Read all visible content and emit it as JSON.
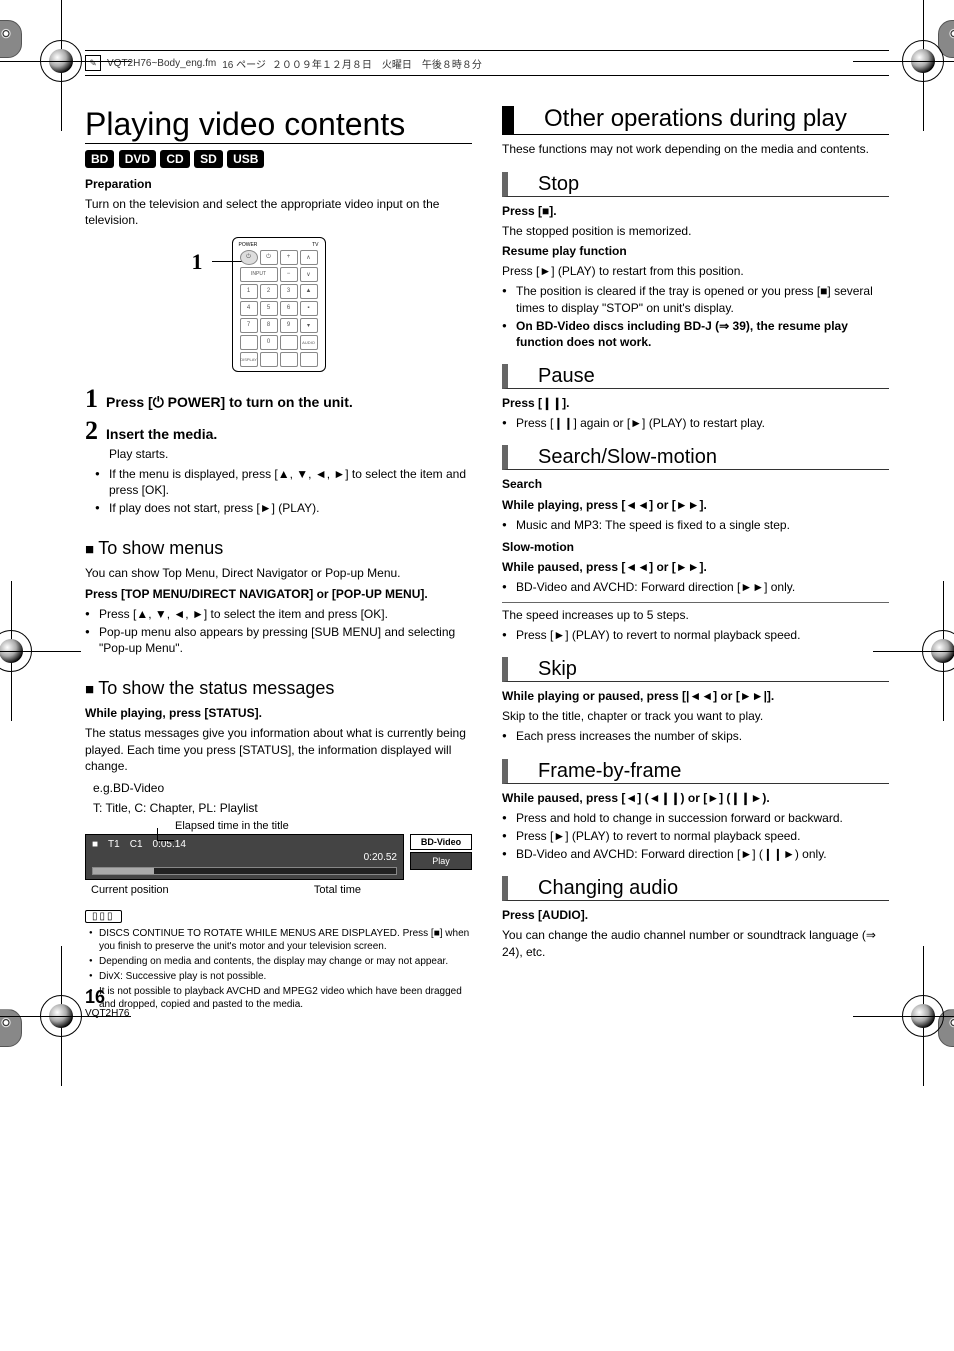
{
  "header": {
    "file": "VQT2H76~Body_eng.fm",
    "page": "16 ページ",
    "date": "２００９年１２月８日　火曜日　午後８時８分"
  },
  "left": {
    "title": "Playing video contents",
    "mediaTags": [
      "BD",
      "DVD",
      "CD",
      "SD",
      "USB"
    ],
    "preparation": {
      "heading": "Preparation",
      "text": "Turn on the television and select the appropriate video input on the television."
    },
    "remoteCallout": "1",
    "steps": {
      "s1": {
        "num": "1",
        "text_a": "Press [",
        "text_b": " POWER] to turn on the unit."
      },
      "s2": {
        "num": "2",
        "text": "Insert the media."
      }
    },
    "playStarts": "Play starts.",
    "afterInsert": [
      "If the menu is displayed, press [▲, ▼, ◄, ►] to select the item and press [OK].",
      "If play does not start, press [►] (PLAY)."
    ],
    "menus": {
      "heading": "To show menus",
      "intro": "You can show Top Menu, Direct Navigator or Pop-up Menu.",
      "press": "Press [TOP MENU/DIRECT NAVIGATOR] or [POP-UP MENU].",
      "bullets": [
        "Press [▲, ▼, ◄, ►] to select the item and press [OK].",
        "Pop-up menu also appears by pressing [SUB MENU] and selecting \"Pop-up Menu\"."
      ]
    },
    "status": {
      "heading": "To show the status messages",
      "press": "While playing, press [STATUS].",
      "desc": "The status messages give you information about what is currently being played. Each time you press [STATUS], the information displayed will change.",
      "eg": "e.g.BD-Video",
      "legend": "T: Title, C: Chapter, PL: Playlist",
      "elapsedLabel": "Elapsed time in the title",
      "t": "T1",
      "c": "C1",
      "elapsed": "0:05.14",
      "total": "0:20.52",
      "bdVideo": "BD-Video",
      "play": "Play",
      "currentPos": "Current position",
      "totalTime": "Total time"
    },
    "notes": [
      "DISCS CONTINUE TO ROTATE WHILE MENUS ARE DISPLAYED. Press [■] when you finish to preserve the unit's motor and your television screen.",
      "Depending on media and contents, the display may change or may not appear.",
      "DivX: Successive play is not possible.",
      "It is not possible to playback AVCHD and MPEG2 video which have been dragged and dropped, copied and pasted to the media."
    ]
  },
  "right": {
    "title": "Other operations during play",
    "intro": "These functions may not work depending on the media and contents.",
    "stop": {
      "heading": "Stop",
      "press": "Press [■].",
      "memorized": "The stopped position is memorized.",
      "resumeHeading": "Resume play function",
      "resumeText": "Press [►] (PLAY) to restart from this position.",
      "bullets": [
        "The position is cleared if the tray is opened or you press [■] several times to display \"STOP\" on unit's display.",
        "On BD-Video discs including BD-J (⇒ 39), the resume play function does not work."
      ]
    },
    "pause": {
      "heading": "Pause",
      "press": "Press [❙❙].",
      "bullets": [
        "Press [❙❙] again or [►] (PLAY) to restart play."
      ]
    },
    "search": {
      "heading": "Search/Slow-motion",
      "searchLabel": "Search",
      "searchPress": "While playing, press [◄◄] or [►►].",
      "searchBullets": [
        "Music and MP3: The speed is fixed to a single step."
      ],
      "slowLabel": "Slow-motion",
      "slowPress": "While paused, press [◄◄] or [►►].",
      "slowBullets": [
        "BD-Video and AVCHD: Forward direction [►►] only."
      ],
      "speed": "The speed increases up to 5 steps.",
      "revert": [
        "Press [►] (PLAY) to revert to normal playback speed."
      ]
    },
    "skip": {
      "heading": "Skip",
      "press": "While playing or paused, press [|◄◄] or [►►|].",
      "desc": "Skip to the title, chapter or track you want to play.",
      "bullets": [
        "Each press increases the number of skips."
      ]
    },
    "frame": {
      "heading": "Frame-by-frame",
      "press": "While paused, press [◄] (◄❙❙) or [►] (❙❙►).",
      "bullets": [
        "Press and hold to change in succession forward or backward.",
        "Press [►] (PLAY) to revert to normal playback speed.",
        "BD-Video and AVCHD: Forward direction [►] (❙❙►) only."
      ]
    },
    "audio": {
      "heading": "Changing audio",
      "press": "Press [AUDIO].",
      "desc": "You can change the audio channel number or soundtrack language (⇒ 24), etc."
    }
  },
  "footer": {
    "pageNum": "16",
    "code": "VQT2H76"
  }
}
